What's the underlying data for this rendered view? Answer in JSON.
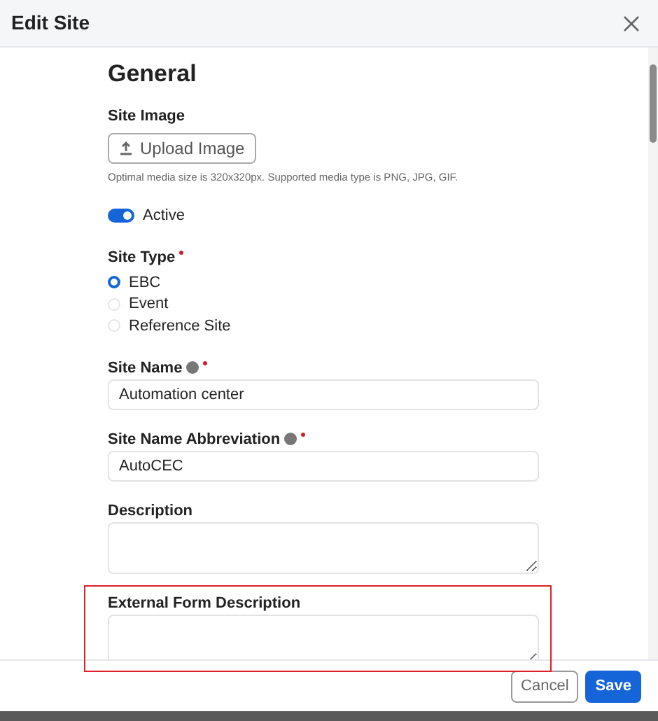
{
  "window": {
    "title": "Edit Site"
  },
  "section": {
    "heading": "General"
  },
  "site_image": {
    "label": "Site Image",
    "button": "Upload Image",
    "hint": "Optimal media size is 320x320px. Supported media type is PNG, JPG, GIF."
  },
  "active_toggle": {
    "label": "Active",
    "on": true
  },
  "site_type": {
    "label": "Site Type",
    "required": true,
    "options": [
      {
        "label": "EBC",
        "selected": true
      },
      {
        "label": "Event",
        "selected": false
      },
      {
        "label": "Reference Site",
        "selected": false
      }
    ]
  },
  "fields": [
    {
      "kind": "input",
      "label": "Site Name",
      "info": true,
      "required": true,
      "value": "Automation center"
    },
    {
      "kind": "input",
      "label": "Site Name Abbreviation",
      "info": true,
      "required": true,
      "value": "AutoCEC"
    },
    {
      "kind": "textarea",
      "label": "Description"
    },
    {
      "kind": "textarea",
      "label": "External Form Description",
      "highlighted": true
    }
  ],
  "buttons": [
    {
      "kind": "secondary",
      "label": "Cancel"
    },
    {
      "kind": "primary",
      "label": "Save"
    }
  ]
}
